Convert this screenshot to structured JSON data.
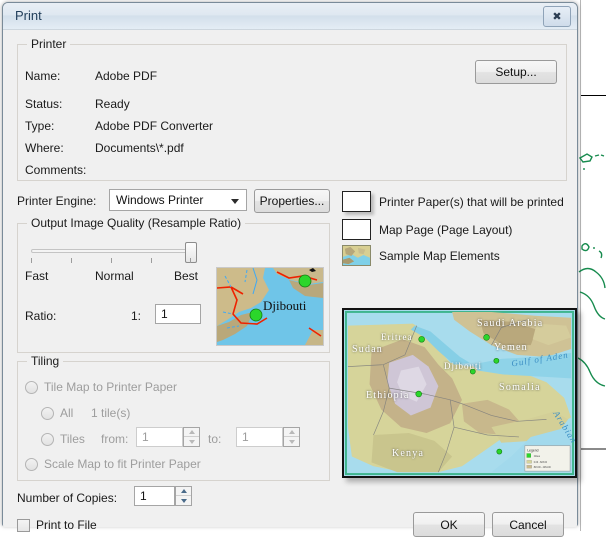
{
  "window": {
    "title": "Print",
    "close_icon": "close-icon",
    "close_glyph": "✖"
  },
  "printer_group": {
    "legend": "Printer",
    "rows": [
      {
        "label": "Name:",
        "value": "Adobe PDF"
      },
      {
        "label": "Status:",
        "value": "Ready"
      },
      {
        "label": "Type:",
        "value": "Adobe PDF Converter"
      },
      {
        "label": "Where:",
        "value": "Documents\\*.pdf"
      },
      {
        "label": "Comments:",
        "value": ""
      }
    ],
    "setup_button": "Setup..."
  },
  "engine_row": {
    "label": "Printer Engine:",
    "selected": "Windows Printer",
    "options": [
      "Windows Printer"
    ],
    "properties_button": "Properties..."
  },
  "quality_group": {
    "legend": "Output Image Quality (Resample Ratio)",
    "slider": {
      "labels": [
        "Fast",
        "Normal",
        "Best"
      ],
      "tick_count": 5,
      "position_percent": 88,
      "min": 0,
      "max": 100
    },
    "ratio_label": "Ratio:",
    "ratio_prefix": "1:",
    "ratio_value": "1",
    "thumbnail": {
      "name": "djibouti-thumbnail",
      "caption": "Djibouti"
    }
  },
  "legend_items": [
    {
      "swatch": "printer-paper-swatch",
      "label": "Printer Paper(s) that will be printed"
    },
    {
      "swatch": "map-page-swatch",
      "label": "Map Page (Page Layout)"
    },
    {
      "swatch": "sample-map-swatch",
      "label": "Sample Map Elements"
    }
  ],
  "tiling_group": {
    "legend": "Tiling",
    "tile_map_option": "Tile Map to Printer Paper",
    "all_option": "All",
    "tile_count_text": "1 tile(s)",
    "tiles_option": "Tiles",
    "from_label": "from:",
    "from_value": "1",
    "to_label": "to:",
    "to_value": "1",
    "scale_option": "Scale Map to fit Printer Paper",
    "enabled": false
  },
  "copies": {
    "label": "Number of Copies:",
    "value": "1"
  },
  "print_to_file": {
    "label": "Print to File",
    "checked": false
  },
  "footer": {
    "ok_button": "OK",
    "cancel_button": "Cancel"
  },
  "map_preview": {
    "name": "map-page-preview",
    "labels": [
      "Saudi Arabia",
      "Yemen",
      "Gulf of Aden",
      "Sudan",
      "Eritrea",
      "Djibouti",
      "Somalia",
      "Ethiopia",
      "Kenya",
      "Arabian"
    ],
    "legend_title": "Legend",
    "legend_entries": [
      "Cities",
      "Value : 0.00 - 823.00",
      "Value : 823.00 - 4264.00"
    ]
  },
  "colors": {
    "dialog_background": "#f0f0f0",
    "titlebar": "#dfe8f1",
    "title_text": "#24405c",
    "sea": "#a8dced",
    "land_low": "#d8d79a",
    "land_mid": "#c3b286",
    "highland": "#cfc6d6",
    "city_dot": "#2bd62b",
    "road": "#ee2200",
    "river": "#3fa9f5",
    "coastline": "#178b4e"
  }
}
